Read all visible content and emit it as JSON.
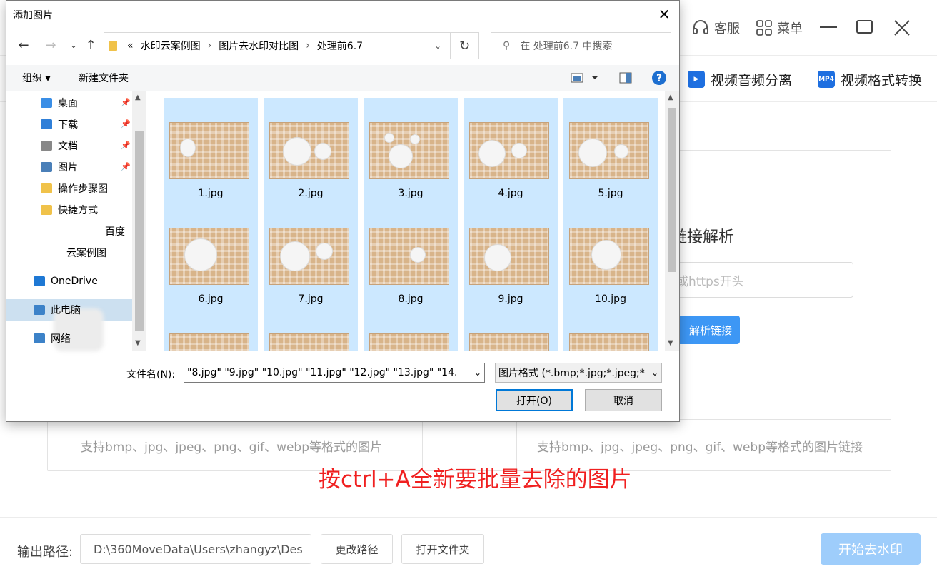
{
  "topbar": {
    "service_label": "客服",
    "menu_label": "菜单"
  },
  "tools": {
    "split_label": "视频音频分离",
    "convert_label": "视频格式转换",
    "convert_icon_text": "MP4"
  },
  "right_panel": {
    "title": "链接解析",
    "url_placeholder": "或https开头",
    "parse_button": "解析链接",
    "hint": "支持bmp、jpg、jpeg、png、gif、webp等格式的图片链接"
  },
  "left_panel": {
    "hint": "支持bmp、jpg、jpeg、png、gif、webp等格式的图片"
  },
  "annotation": "按ctrl+A全新要批量去除的图片",
  "bottom": {
    "output_label": "输出路径:",
    "output_path": "D:\\360MoveData\\Users\\zhangyz\\Des",
    "change_path": "更改路径",
    "open_folder": "打开文件夹",
    "start": "开始去水印"
  },
  "dialog": {
    "title": "添加图片",
    "breadcrumb_prefix": "«",
    "breadcrumbs": [
      "水印云案例图",
      "图片去水印对比图",
      "处理前6.7"
    ],
    "search_placeholder": "在 处理前6.7 中搜索",
    "organize": "组织 ▾",
    "new_folder": "新建文件夹",
    "nav": [
      {
        "label": "桌面",
        "pinned": true,
        "color": "#3a8ee6"
      },
      {
        "label": "下载",
        "pinned": true,
        "color": "#2f7fd8"
      },
      {
        "label": "文档",
        "pinned": true,
        "color": "#888888"
      },
      {
        "label": "图片",
        "pinned": true,
        "color": "#4a7fb8"
      },
      {
        "label": "操作步骤图",
        "pinned": false,
        "color": "#f0c24a"
      },
      {
        "label": "快捷方式",
        "pinned": false,
        "color": "#f0c24a"
      },
      {
        "label": "百度",
        "pinned": false,
        "color": "#f0c24a"
      },
      {
        "label": "云案例图",
        "pinned": false,
        "color": "#f0c24a"
      },
      {
        "label": "OneDrive",
        "pinned": false,
        "color": "#1e78d4"
      },
      {
        "label": "此电脑",
        "pinned": false,
        "color": "#3c82c8"
      },
      {
        "label": "网络",
        "pinned": false,
        "color": "#3c82c8"
      }
    ],
    "files": [
      "1.jpg",
      "2.jpg",
      "3.jpg",
      "4.jpg",
      "5.jpg",
      "6.jpg",
      "7.jpg",
      "8.jpg",
      "9.jpg",
      "10.jpg",
      "",
      "",
      "",
      "",
      ""
    ],
    "filename_label": "文件名(N):",
    "filename_value": "\"8.jpg\" \"9.jpg\" \"10.jpg\" \"11.jpg\" \"12.jpg\" \"13.jpg\" \"14.",
    "filetype_value": "图片格式 (*.bmp;*.jpg;*.jpeg;*",
    "open_button": "打开(O)",
    "cancel_button": "取消"
  }
}
